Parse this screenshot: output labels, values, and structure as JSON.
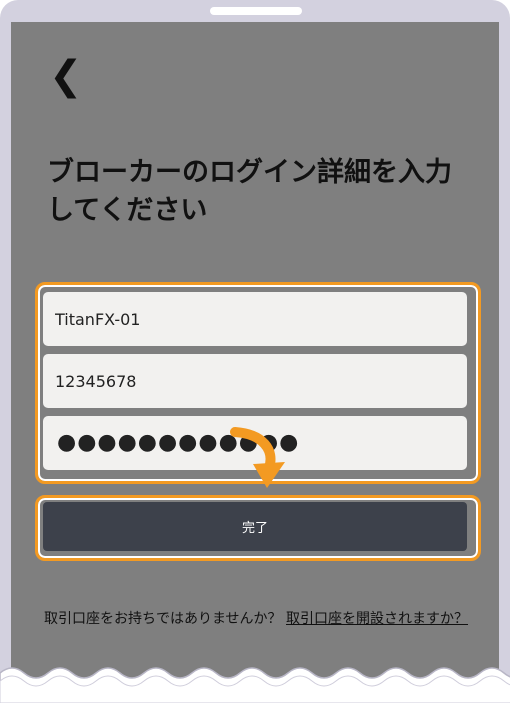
{
  "nav": {
    "back_glyph": "❮"
  },
  "page": {
    "title": "ブローカーのログイン詳細を入力してください"
  },
  "form": {
    "server_value": "TitanFX-01",
    "account_value": "12345678",
    "password_mask": "●●●●●●●●●●●●"
  },
  "actions": {
    "done_label": "完了"
  },
  "footer": {
    "question": "取引口座をお持ちではありませんか？",
    "link_text": "取引口座を開設されますか？"
  },
  "colors": {
    "highlight": "#f39a22",
    "button": "#3d414b",
    "screen_bg": "#7f7f7f",
    "field_bg": "#f2f1ef"
  },
  "icons": {
    "back": "chevron-left-icon",
    "pointer": "curved-arrow-icon"
  }
}
